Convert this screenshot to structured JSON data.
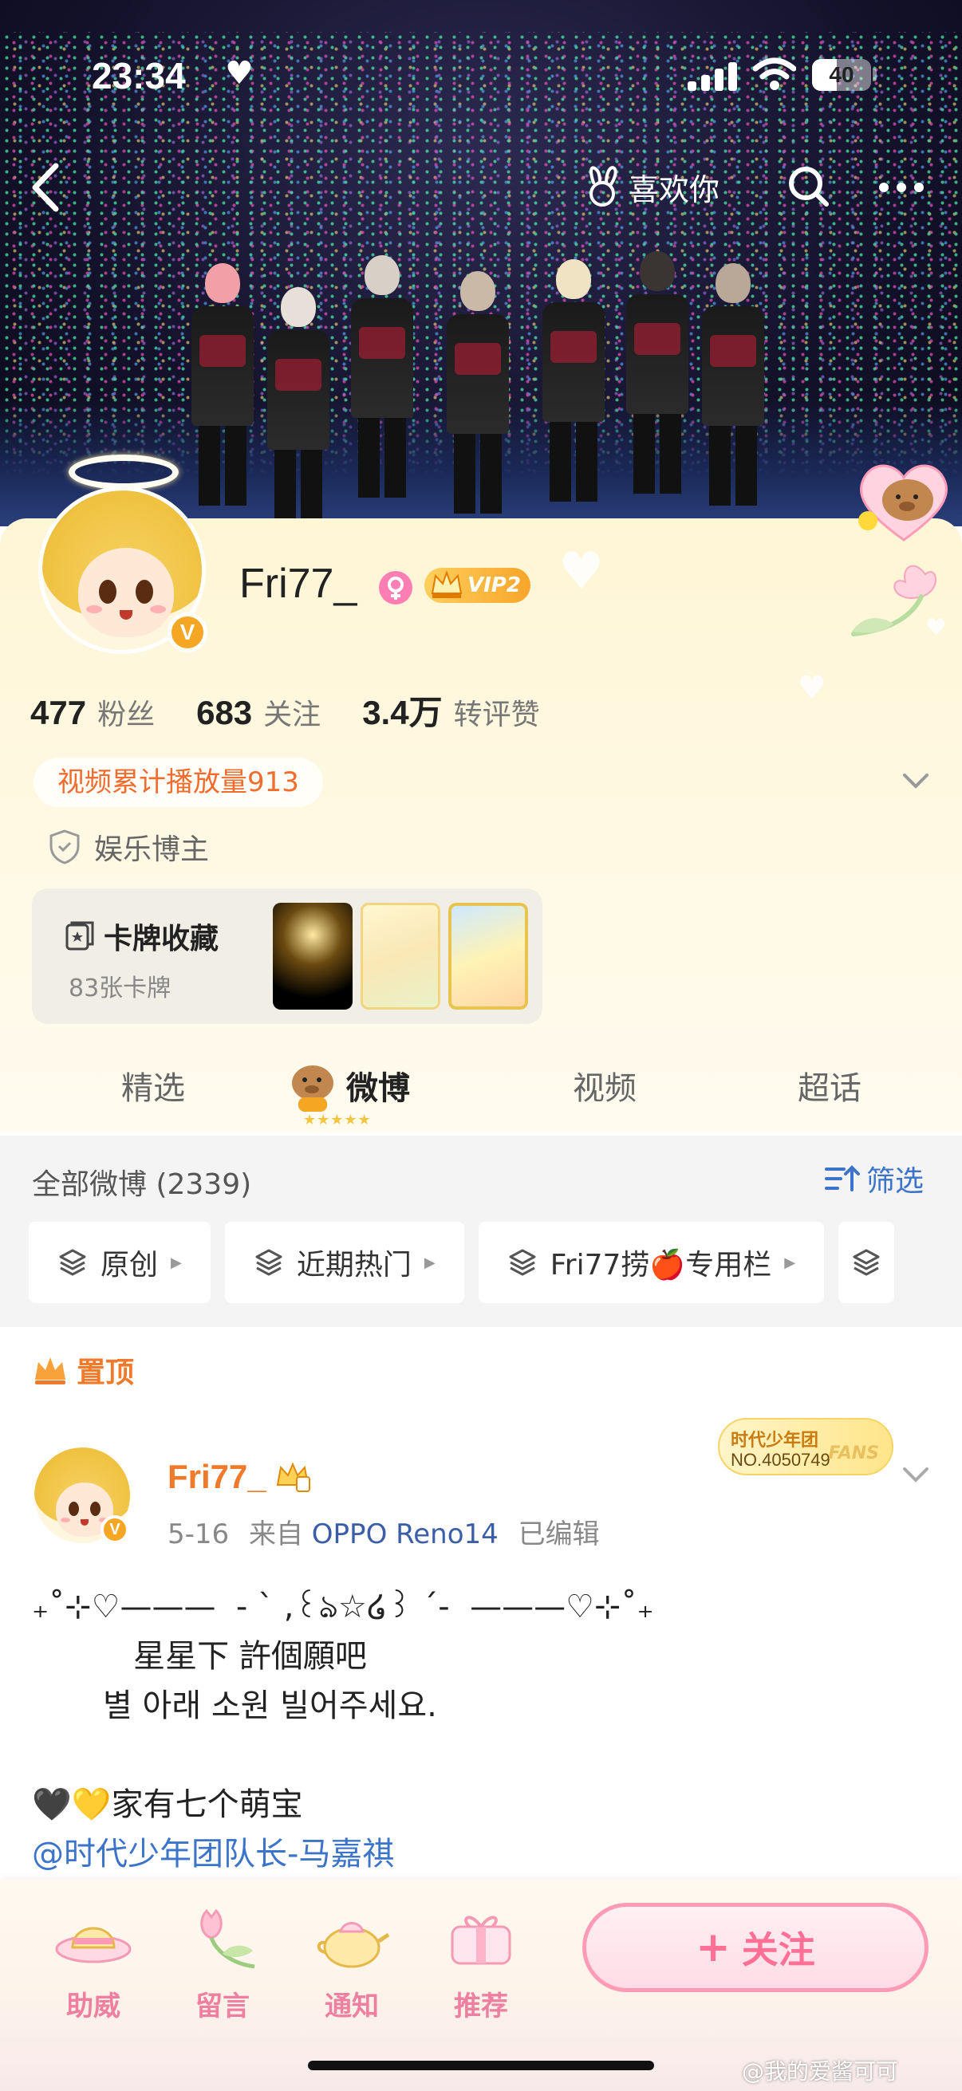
{
  "status_bar": {
    "time": "23:34",
    "battery": "40"
  },
  "nav": {
    "like_label": "喜欢你"
  },
  "profile": {
    "username": "Fri77_",
    "vip_label": "VIP2",
    "stats": [
      {
        "value": "477",
        "label": "粉丝"
      },
      {
        "value": "683",
        "label": "关注"
      },
      {
        "value": "3.4万",
        "label": "转评赞"
      }
    ],
    "play_count": "视频累计播放量913",
    "role": "娱乐博主",
    "cards": {
      "title": "卡牌收藏",
      "subtitle": "83张卡牌"
    }
  },
  "tabs": [
    "精选",
    "微博",
    "视频",
    "超话"
  ],
  "feed": {
    "title": "全部微博 (2339)",
    "filter_label": "筛选",
    "chips": [
      "原创",
      "近期热门",
      "Fri77捞🍎专用栏"
    ]
  },
  "post": {
    "pinned_label": "置顶",
    "author": "Fri77_",
    "date": "5-16",
    "from_label": "来自",
    "device": "OPPO Reno14",
    "edited": "已编辑",
    "fans_badge": {
      "team": "时代少年团",
      "number": "NO.4050749",
      "fans": "FANS"
    },
    "lines": [
      "₊˚⊹♡———  - ` ,꒰ঌ☆໒꒱ ´-  ———♡⊹˚₊",
      "          星星下 許個願吧",
      "       별 아래 소원 빌어주세요.",
      "",
      "🖤💛家有七个萌宝"
    ],
    "mention": "@时代少年团队长-马嘉祺"
  },
  "bottom_bar": {
    "items": [
      {
        "label": "助威",
        "icon": "hat-icon"
      },
      {
        "label": "留言",
        "icon": "tulip-icon"
      },
      {
        "label": "通知",
        "icon": "teapot-icon"
      },
      {
        "label": "推荐",
        "icon": "gift-icon"
      }
    ],
    "follow_label": "关注"
  },
  "watermark": "@我的爱酱可可",
  "colors": {
    "accent_orange": "#f07a2a",
    "link_blue": "#3b74c9",
    "follow_pink": "#ff6f96",
    "panel_cream": "#fff6d6"
  }
}
